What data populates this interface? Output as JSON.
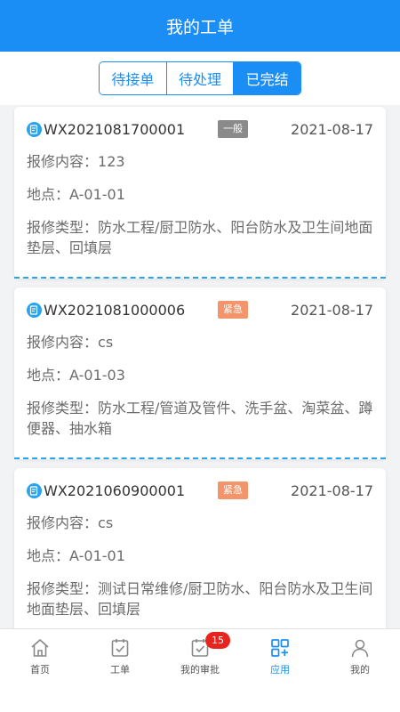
{
  "header": {
    "title": "我的工单"
  },
  "tabs": [
    {
      "label": "待接单",
      "active": false
    },
    {
      "label": "待处理",
      "active": false
    },
    {
      "label": "已完结",
      "active": true
    }
  ],
  "orders": [
    {
      "order_no": "WX2021081700001",
      "priority": "一般",
      "priority_level": "normal",
      "date": "2021-08-17",
      "content_label": "报修内容：",
      "content": "123",
      "location_label": "地点：",
      "location": "A-01-01",
      "type_label": "报修类型：",
      "type": "防水工程/厨卫防水、阳台防水及卫生间地面垫层、回填层"
    },
    {
      "order_no": "WX2021081000006",
      "priority": "紧急",
      "priority_level": "urgent",
      "date": "2021-08-17",
      "content_label": "报修内容：",
      "content": "cs",
      "location_label": "地点：",
      "location": "A-01-03",
      "type_label": "报修类型：",
      "type": "防水工程/管道及管件、洗手盆、淘菜盆、蹲便器、抽水箱"
    },
    {
      "order_no": "WX2021060900001",
      "priority": "紧急",
      "priority_level": "urgent",
      "date": "2021-08-17",
      "content_label": "报修内容：",
      "content": "cs",
      "location_label": "地点：",
      "location": "A-01-01",
      "type_label": "报修类型：",
      "type": "测试日常维修/厨卫防水、阳台防水及卫生间地面垫层、回填层"
    }
  ],
  "bottom_nav": [
    {
      "label": "首页",
      "icon": "home-icon",
      "active": false
    },
    {
      "label": "工单",
      "icon": "work-order-icon",
      "active": false
    },
    {
      "label": "我的审批",
      "icon": "approval-icon",
      "active": false,
      "badge": "15"
    },
    {
      "label": "应用",
      "icon": "apps-icon",
      "active": true
    },
    {
      "label": "我的",
      "icon": "user-icon",
      "active": false
    }
  ],
  "colors": {
    "primary": "#1a8ef5",
    "urgent": "#f3946b",
    "normal": "#8a8a8a",
    "badge": "#e8241e"
  }
}
